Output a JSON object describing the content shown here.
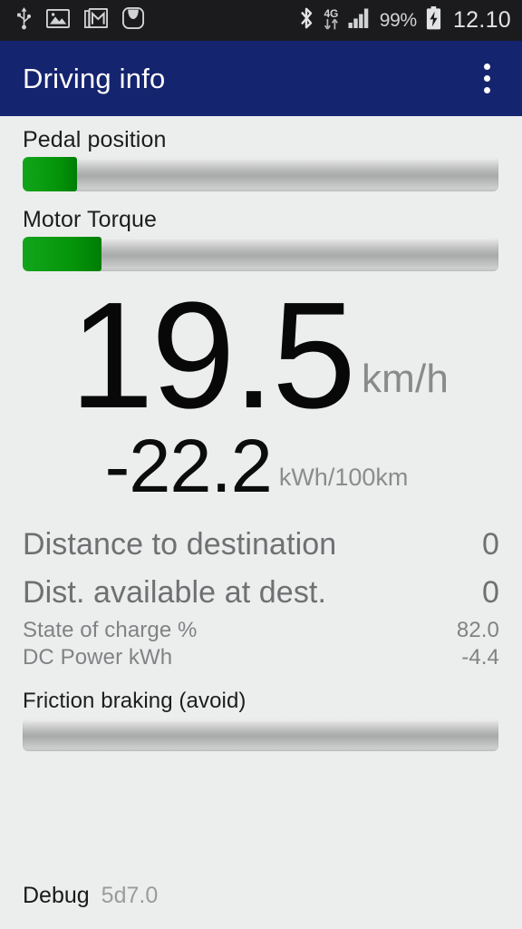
{
  "statusbar": {
    "left_icons": [
      "usb-icon",
      "gallery-image-icon",
      "mail-icon",
      "galaxy-apps-icon"
    ],
    "galaxy_label": "Galaxy",
    "bluetooth_icon": "bluetooth-icon",
    "network_label": "4G",
    "network_arrows_icon": "data-transfer-arrows-icon",
    "signal_icon": "signal-bars-icon",
    "battery_percent": "99%",
    "battery_icon": "battery-charging-icon",
    "clock": "12.10"
  },
  "appbar": {
    "title": "Driving info",
    "overflow_icon": "overflow-menu-icon",
    "background": "#15246e"
  },
  "meters": {
    "pedal": {
      "label": "Pedal position",
      "fill_percent": 11.5
    },
    "torque": {
      "label": "Motor Torque",
      "fill_percent": 16.6
    },
    "friction": {
      "label": "Friction braking (avoid)",
      "fill_percent": 0
    },
    "fill_color": "#069410",
    "track_color": "#b4b5b5"
  },
  "speed": {
    "value": "19.5",
    "unit": "km/h"
  },
  "consumption": {
    "value": "-22.2",
    "unit": "kWh/100km"
  },
  "rows": [
    {
      "label": "Distance to destination",
      "value": "0",
      "size": "big"
    },
    {
      "label": "Dist. available at dest.",
      "value": "0",
      "size": "big"
    },
    {
      "label": "State of charge %",
      "value": "82.0",
      "size": "small"
    },
    {
      "label": "DC Power kWh",
      "value": "-4.4",
      "size": "small"
    }
  ],
  "debug": {
    "label": "Debug",
    "value": "5d7.0"
  }
}
